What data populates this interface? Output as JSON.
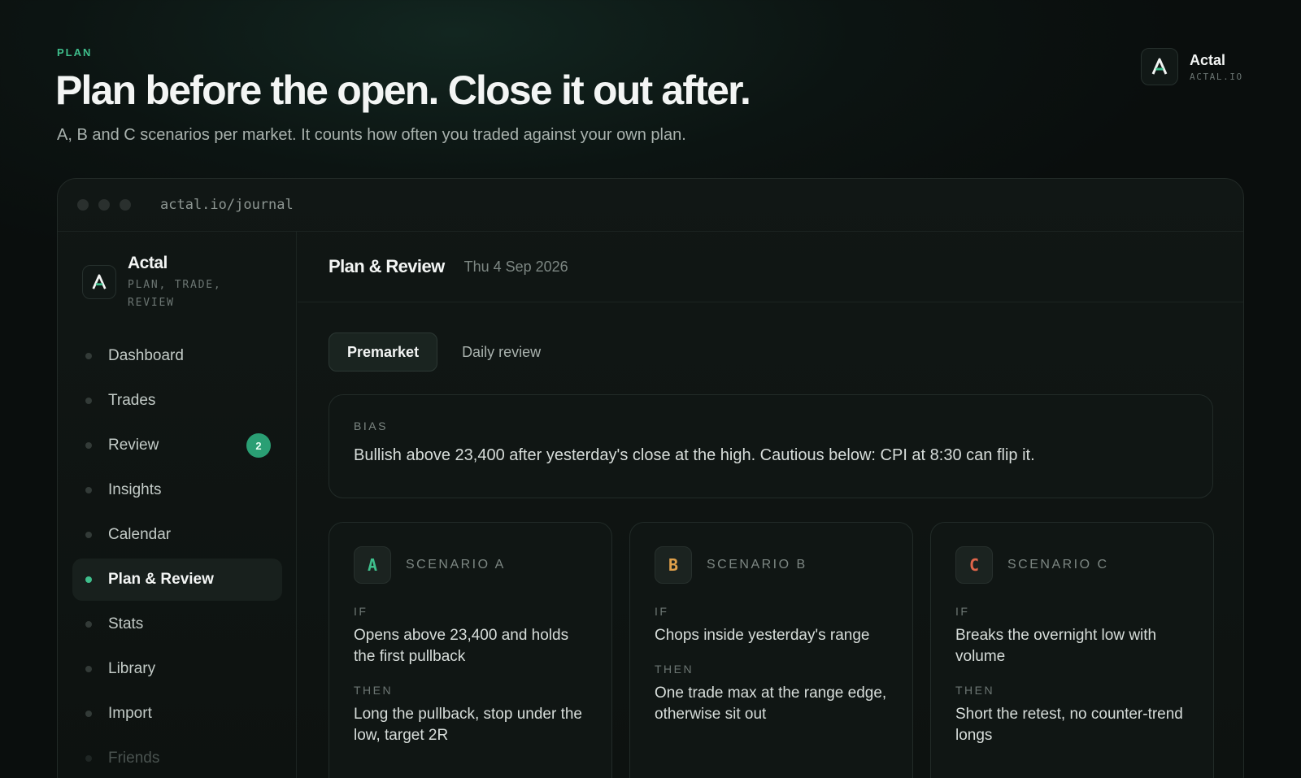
{
  "hero": {
    "eyebrow": "PLAN",
    "title": "Plan before the open. Close it out after.",
    "subtitle": "A, B and C scenarios per market. It counts how often you traded against your own plan."
  },
  "brand": {
    "name": "Actal",
    "domain": "ACTAL.IO",
    "logo_icon": "a-logo-icon"
  },
  "browser": {
    "url": "actal.io/journal"
  },
  "sidebar": {
    "brand_name": "Actal",
    "tagline": "PLAN, TRADE, REVIEW",
    "items": [
      {
        "label": "Dashboard"
      },
      {
        "label": "Trades"
      },
      {
        "label": "Review",
        "badge": "2"
      },
      {
        "label": "Insights"
      },
      {
        "label": "Calendar"
      },
      {
        "label": "Plan & Review",
        "active": true
      },
      {
        "label": "Stats"
      },
      {
        "label": "Library"
      },
      {
        "label": "Import"
      },
      {
        "label": "Friends"
      }
    ]
  },
  "main": {
    "title": "Plan & Review",
    "date": "Thu 4 Sep 2026",
    "tabs": [
      {
        "label": "Premarket",
        "active": true
      },
      {
        "label": "Daily review"
      }
    ],
    "bias": {
      "label": "BIAS",
      "text": "Bullish above 23,400 after yesterday's close at the high. Cautious below: CPI at 8:30 can flip it."
    },
    "scenarios": [
      {
        "letter": "A",
        "title": "SCENARIO A",
        "color": "#3fbf8c",
        "if_label": "IF",
        "if_text": "Opens above 23,400 and holds the first pullback",
        "then_label": "THEN",
        "then_text": "Long the pullback, stop under the low, target 2R"
      },
      {
        "letter": "B",
        "title": "SCENARIO B",
        "color": "#e0a04a",
        "if_label": "IF",
        "if_text": "Chops inside yesterday's range",
        "then_label": "THEN",
        "then_text": "One trade max at the range edge, otherwise sit out"
      },
      {
        "letter": "C",
        "title": "SCENARIO C",
        "color": "#e0654a",
        "if_label": "IF",
        "if_text": "Breaks the overnight low with volume",
        "then_label": "THEN",
        "then_text": "Short the retest, no counter-trend longs"
      }
    ]
  },
  "colors": {
    "accent": "#3fbf8c",
    "background": "#0a0e0d"
  }
}
